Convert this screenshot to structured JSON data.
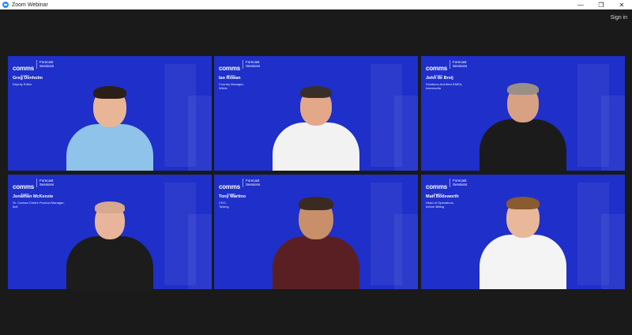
{
  "window": {
    "title": "Zoom Webinar",
    "controls": [
      "—",
      "❐",
      "✕"
    ]
  },
  "header": {
    "sign_in": "Sign in"
  },
  "brand": {
    "logo": "comms",
    "sub": "dealer",
    "line1": "Forecast",
    "line2": "Sessions"
  },
  "participants": [
    {
      "name": "Greg Denholm",
      "role_lines": [
        "Deputy Editor"
      ]
    },
    {
      "name": "Ian Rowan",
      "role_lines": [
        "Country Manager,",
        "Wildix"
      ]
    },
    {
      "name": "John de Breij",
      "role_lines": [
        "Solutions Architect EMEA,",
        "Intermedia"
      ]
    },
    {
      "name": "Jonathan McKenzie",
      "role_lines": [
        "Sr. Contact Centre Product Manager,",
        "8x8"
      ]
    },
    {
      "name": "Tony Martino",
      "role_lines": [
        "CEO,",
        "Tollring"
      ]
    },
    {
      "name": "Matt Bodsworth",
      "role_lines": [
        "Head of Operations,",
        "Inform Billing"
      ]
    }
  ],
  "colors": {
    "tile_bg": "#1f2fc9",
    "stage_bg": "#1a1a1a"
  }
}
